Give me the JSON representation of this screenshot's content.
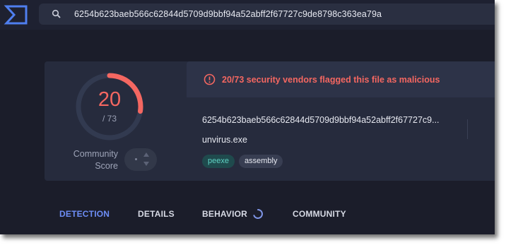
{
  "search": {
    "query": "6254b623baeb566c62844d5709d9bbf94a52abff2f67727c9de8798c363ea79a"
  },
  "score": {
    "detections": "20",
    "total": "/ 73",
    "fraction": 0.274,
    "community_label_line1": "Community",
    "community_label_line2": "Score"
  },
  "alert": {
    "text": "20/73 security vendors flagged this file as malicious"
  },
  "file": {
    "hash_truncated": "6254b623baeb566c62844d5709d9bbf94a52abff2f67727c9...",
    "name": "unvirus.exe",
    "tags": [
      "peexe",
      "assembly"
    ]
  },
  "tabs": {
    "detection": "DETECTION",
    "details": "DETAILS",
    "behavior": "BEHAVIOR",
    "community": "COMMUNITY"
  },
  "colors": {
    "background": "#1b1d2a",
    "card": "#262b3d",
    "malicious_red": "#f46761",
    "accent_blue": "#6d8df5",
    "tag_teal": "#5fd2c4"
  },
  "icons": {
    "logo": "virustotal-logo-icon",
    "search": "search-icon",
    "alert": "alert-circle-icon",
    "spinner": "loading-spinner-icon"
  }
}
